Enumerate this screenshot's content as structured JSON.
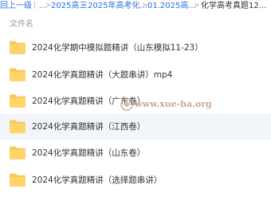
{
  "breadcrumb": {
    "back": "回上一级",
    "items": [
      "...",
      "2025高三",
      "2025年高考化...",
      "01.2025高..."
    ],
    "current": "化学高考真题12..."
  },
  "list": {
    "column_header": "文件名",
    "files": [
      {
        "name": "2024化学期中模拟题精讲（山东模拟11-23）",
        "icon": "folder-icon"
      },
      {
        "name": "2024化学真题精讲（大题串讲）mp4",
        "icon": "folder-icon"
      },
      {
        "name": "2024化学真题精讲（广东卷）",
        "icon": "folder-icon"
      },
      {
        "name": "2024化学真题精讲（江西卷）",
        "icon": "folder-icon"
      },
      {
        "name": "2024化学真题精讲（山东卷）",
        "icon": "folder-icon"
      },
      {
        "name": "2024化学真题精讲（选择题串讲）",
        "icon": "folder-icon"
      }
    ]
  },
  "watermark": {
    "text": "www.xue-ba.org"
  },
  "colors": {
    "link": "#2a6fe0",
    "folder": "#f7c85a",
    "hover_row": "#f2f5fa"
  }
}
